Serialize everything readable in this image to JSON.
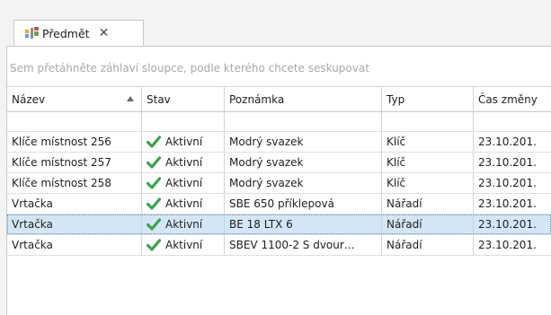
{
  "tab": {
    "label": "Předmět",
    "close": "✕"
  },
  "group_panel": {
    "hint": "Sem přetáhněte záhlaví sloupce, podle kterého chcete seskupovat"
  },
  "columns": {
    "name": "Název",
    "state": "Stav",
    "note": "Poznámka",
    "type": "Typ",
    "time": "Čas změny"
  },
  "rows": [
    {
      "name": "Klíče místnost 256",
      "state": "Aktivní",
      "note": "Modrý svazek",
      "type": "Klíč",
      "time": "23.10.201."
    },
    {
      "name": "Klíče místnost 257",
      "state": "Aktivní",
      "note": "Modrý svazek",
      "type": "Klíč",
      "time": "23.10.201."
    },
    {
      "name": "Klíče místnost 258",
      "state": "Aktivní",
      "note": "Modrý svazek",
      "type": "Klíč",
      "time": "23.10.201."
    },
    {
      "name": "Vrtačka",
      "state": "Aktivní",
      "note": "SBE 650 příklepová",
      "type": "Nářadí",
      "time": "23.10.201."
    },
    {
      "name": "Vrtačka",
      "state": "Aktivní",
      "note": "BE 18 LTX 6",
      "type": "Nářadí",
      "time": "23.10.201."
    },
    {
      "name": "Vrtačka",
      "state": "Aktivní",
      "note": "SBEV 1100-2 S dvour…",
      "type": "Nářadí",
      "time": "23.10.201."
    }
  ],
  "selected_row": 4,
  "sort": {
    "column": "name",
    "direction": "ascending"
  },
  "colors": {
    "check": "#3aa34a",
    "selection": "#d4e6f6",
    "hint": "#a8a8a8"
  },
  "icons": {
    "tab": "object-icon",
    "state": "checkmark-icon",
    "sort": "sort-ascending-icon"
  }
}
